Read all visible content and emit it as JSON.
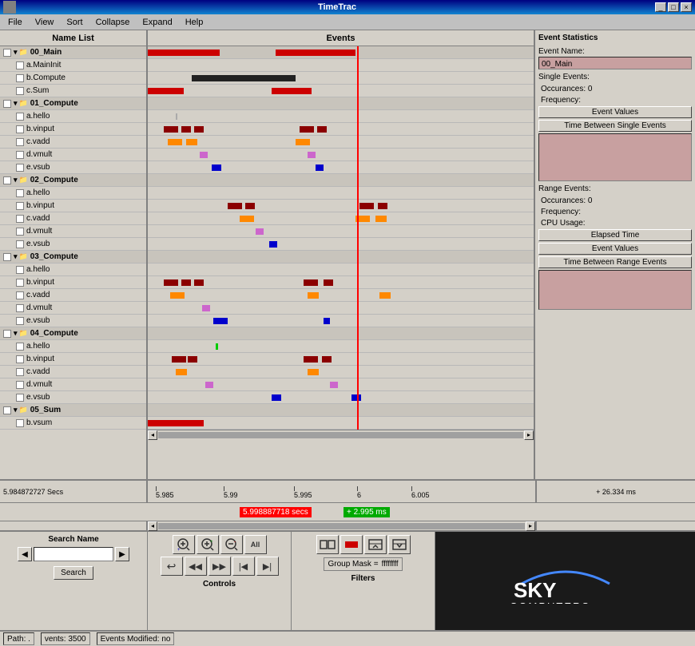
{
  "app": {
    "title": "TimeTrac",
    "window_controls": [
      "_",
      "□",
      "×"
    ]
  },
  "menu": {
    "items": [
      "File",
      "View",
      "Sort",
      "Collapse",
      "Expand",
      "Help"
    ]
  },
  "panels": {
    "name_list_header": "Name List",
    "events_header": "Events",
    "stats_header": "Event Statistics"
  },
  "tree_items": [
    {
      "id": "g0",
      "label": "00_Main",
      "type": "group",
      "indent": 0
    },
    {
      "id": "a_main",
      "label": "a.MainInit",
      "type": "child",
      "indent": 1
    },
    {
      "id": "b_compute",
      "label": "b.Compute",
      "type": "child",
      "indent": 1
    },
    {
      "id": "c_sum",
      "label": "c.Sum",
      "type": "child",
      "indent": 1
    },
    {
      "id": "g1",
      "label": "01_Compute",
      "type": "group",
      "indent": 0
    },
    {
      "id": "a_hello1",
      "label": "a.hello",
      "type": "child",
      "indent": 1
    },
    {
      "id": "b_vinput1",
      "label": "b.vinput",
      "type": "child",
      "indent": 1
    },
    {
      "id": "c_vadd1",
      "label": "c.vadd",
      "type": "child",
      "indent": 1
    },
    {
      "id": "d_vmult1",
      "label": "d.vmult",
      "type": "child",
      "indent": 1
    },
    {
      "id": "e_vsub1",
      "label": "e.vsub",
      "type": "child",
      "indent": 1
    },
    {
      "id": "g2",
      "label": "02_Compute",
      "type": "group",
      "indent": 0
    },
    {
      "id": "a_hello2",
      "label": "a.hello",
      "type": "child",
      "indent": 1
    },
    {
      "id": "b_vinput2",
      "label": "b.vinput",
      "type": "child",
      "indent": 1
    },
    {
      "id": "c_vadd2",
      "label": "c.vadd",
      "type": "child",
      "indent": 1
    },
    {
      "id": "d_vmult2",
      "label": "d.vmult",
      "type": "child",
      "indent": 1
    },
    {
      "id": "e_vsub2",
      "label": "e.vsub",
      "type": "child",
      "indent": 1
    },
    {
      "id": "g3",
      "label": "03_Compute",
      "type": "group",
      "indent": 0
    },
    {
      "id": "a_hello3",
      "label": "a.hello",
      "type": "child",
      "indent": 1
    },
    {
      "id": "b_vinput3",
      "label": "b.vinput",
      "type": "child",
      "indent": 1
    },
    {
      "id": "c_vadd3",
      "label": "c.vadd",
      "type": "child",
      "indent": 1
    },
    {
      "id": "d_vmult3",
      "label": "d.vmult",
      "type": "child",
      "indent": 1
    },
    {
      "id": "e_vsub3",
      "label": "e.vsub",
      "type": "child",
      "indent": 1
    },
    {
      "id": "g4",
      "label": "04_Compute",
      "type": "group",
      "indent": 0
    },
    {
      "id": "a_hello4",
      "label": "a.hello",
      "type": "child",
      "indent": 1
    },
    {
      "id": "b_vinput4",
      "label": "b.vinput",
      "type": "child",
      "indent": 1
    },
    {
      "id": "c_vadd4",
      "label": "c.vadd",
      "type": "child",
      "indent": 1
    },
    {
      "id": "d_vmult4",
      "label": "d.vmult",
      "type": "child",
      "indent": 1
    },
    {
      "id": "e_vsub4",
      "label": "e.vsub",
      "type": "child",
      "indent": 1
    },
    {
      "id": "g5",
      "label": "05_Sum",
      "type": "group",
      "indent": 0
    },
    {
      "id": "b_vsum",
      "label": "b.vsum",
      "type": "child",
      "indent": 1
    }
  ],
  "stats": {
    "event_name_label": "Event Name:",
    "event_name_value": "00_Main",
    "single_events_label": "Single Events:",
    "occurrences_label": "Occurances: 0",
    "frequency_label": "Frequency:",
    "event_values_btn": "Event Values",
    "time_between_single_btn": "Time Between Single Events",
    "range_events_label": "Range Events:",
    "range_occ_label": "Occurances: 0",
    "range_freq_label": "Frequency:",
    "cpu_usage_label": "CPU Usage:",
    "elapsed_time_btn": "Elapsed Time",
    "range_event_values_btn": "Event Values",
    "time_between_range_btn": "Time Between Range Events"
  },
  "timeline": {
    "left_time": "5.984872727 Secs",
    "marker_5985": "5.985",
    "marker_599": "5.99",
    "marker_5995": "5.995",
    "marker_6": "6",
    "marker_6005": "6.005",
    "right_delta": "+ 26.334 ms",
    "cursor_time": "5.998887718 secs",
    "cursor_delta": "+ 2.995 ms"
  },
  "search": {
    "label": "Search Name",
    "placeholder": "",
    "search_btn": "Search"
  },
  "controls": {
    "label": "Controls"
  },
  "filters": {
    "label": "Filters",
    "group_mask_label": "Group Mask =",
    "group_mask_value": "ffffffff"
  },
  "status_bar": {
    "path": "Path:  .",
    "events": "vents: 3500",
    "modified": "Events Modified: no"
  }
}
